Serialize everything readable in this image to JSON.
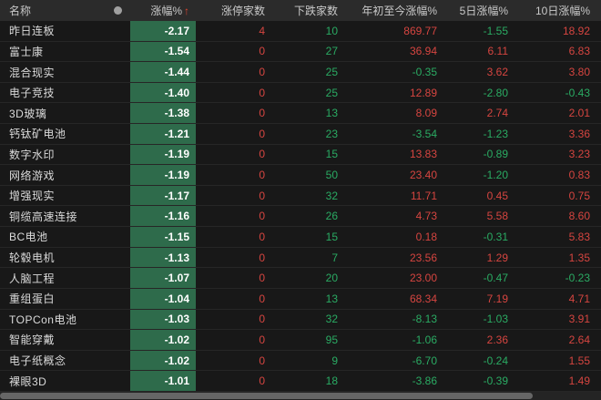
{
  "header": {
    "name_label": "名称",
    "dot_icon": "circle",
    "chg_label": "涨幅%",
    "sort_arrow": "↑",
    "limit_up_label": "涨停家数",
    "down_label": "下跌家数",
    "ytd_label": "年初至今涨幅%",
    "d5_label": "5日涨幅%",
    "d10_label": "10日涨幅%"
  },
  "colors": {
    "gain_red": "#d64540",
    "loss_green": "#2aab63",
    "chg_bar_green": "#2e6b4b",
    "header_bg": "#2b2b2b",
    "row_bg": "#181818"
  },
  "rows": [
    {
      "name": "昨日连板",
      "chg": "-2.17",
      "limit_up": "4",
      "down": "10",
      "ytd": "869.77",
      "d5": "-1.55",
      "d10": "18.92"
    },
    {
      "name": "富士康",
      "chg": "-1.54",
      "limit_up": "0",
      "down": "27",
      "ytd": "36.94",
      "d5": "6.11",
      "d10": "6.83"
    },
    {
      "name": "混合现实",
      "chg": "-1.44",
      "limit_up": "0",
      "down": "25",
      "ytd": "-0.35",
      "d5": "3.62",
      "d10": "3.80"
    },
    {
      "name": "电子竞技",
      "chg": "-1.40",
      "limit_up": "0",
      "down": "25",
      "ytd": "12.89",
      "d5": "-2.80",
      "d10": "-0.43"
    },
    {
      "name": "3D玻璃",
      "chg": "-1.38",
      "limit_up": "0",
      "down": "13",
      "ytd": "8.09",
      "d5": "2.74",
      "d10": "2.01"
    },
    {
      "name": "钙钛矿电池",
      "chg": "-1.21",
      "limit_up": "0",
      "down": "23",
      "ytd": "-3.54",
      "d5": "-1.23",
      "d10": "3.36"
    },
    {
      "name": "数字水印",
      "chg": "-1.19",
      "limit_up": "0",
      "down": "15",
      "ytd": "13.83",
      "d5": "-0.89",
      "d10": "3.23"
    },
    {
      "name": "网络游戏",
      "chg": "-1.19",
      "limit_up": "0",
      "down": "50",
      "ytd": "23.40",
      "d5": "-1.20",
      "d10": "0.83"
    },
    {
      "name": "增强现实",
      "chg": "-1.17",
      "limit_up": "0",
      "down": "32",
      "ytd": "11.71",
      "d5": "0.45",
      "d10": "0.75"
    },
    {
      "name": "铜缆高速连接",
      "chg": "-1.16",
      "limit_up": "0",
      "down": "26",
      "ytd": "4.73",
      "d5": "5.58",
      "d10": "8.60"
    },
    {
      "name": "BC电池",
      "chg": "-1.15",
      "limit_up": "0",
      "down": "15",
      "ytd": "0.18",
      "d5": "-0.31",
      "d10": "5.83"
    },
    {
      "name": "轮毂电机",
      "chg": "-1.13",
      "limit_up": "0",
      "down": "7",
      "ytd": "23.56",
      "d5": "1.29",
      "d10": "1.35"
    },
    {
      "name": "人脑工程",
      "chg": "-1.07",
      "limit_up": "0",
      "down": "20",
      "ytd": "23.00",
      "d5": "-0.47",
      "d10": "-0.23"
    },
    {
      "name": "重组蛋白",
      "chg": "-1.04",
      "limit_up": "0",
      "down": "13",
      "ytd": "68.34",
      "d5": "7.19",
      "d10": "4.71"
    },
    {
      "name": "TOPCon电池",
      "chg": "-1.03",
      "limit_up": "0",
      "down": "32",
      "ytd": "-8.13",
      "d5": "-1.03",
      "d10": "3.91"
    },
    {
      "name": "智能穿戴",
      "chg": "-1.02",
      "limit_up": "0",
      "down": "95",
      "ytd": "-1.06",
      "d5": "2.36",
      "d10": "2.64"
    },
    {
      "name": "电子纸概念",
      "chg": "-1.02",
      "limit_up": "0",
      "down": "9",
      "ytd": "-6.70",
      "d5": "-0.24",
      "d10": "1.55"
    },
    {
      "name": "裸眼3D",
      "chg": "-1.01",
      "limit_up": "0",
      "down": "18",
      "ytd": "-3.86",
      "d5": "-0.39",
      "d10": "1.49"
    }
  ]
}
